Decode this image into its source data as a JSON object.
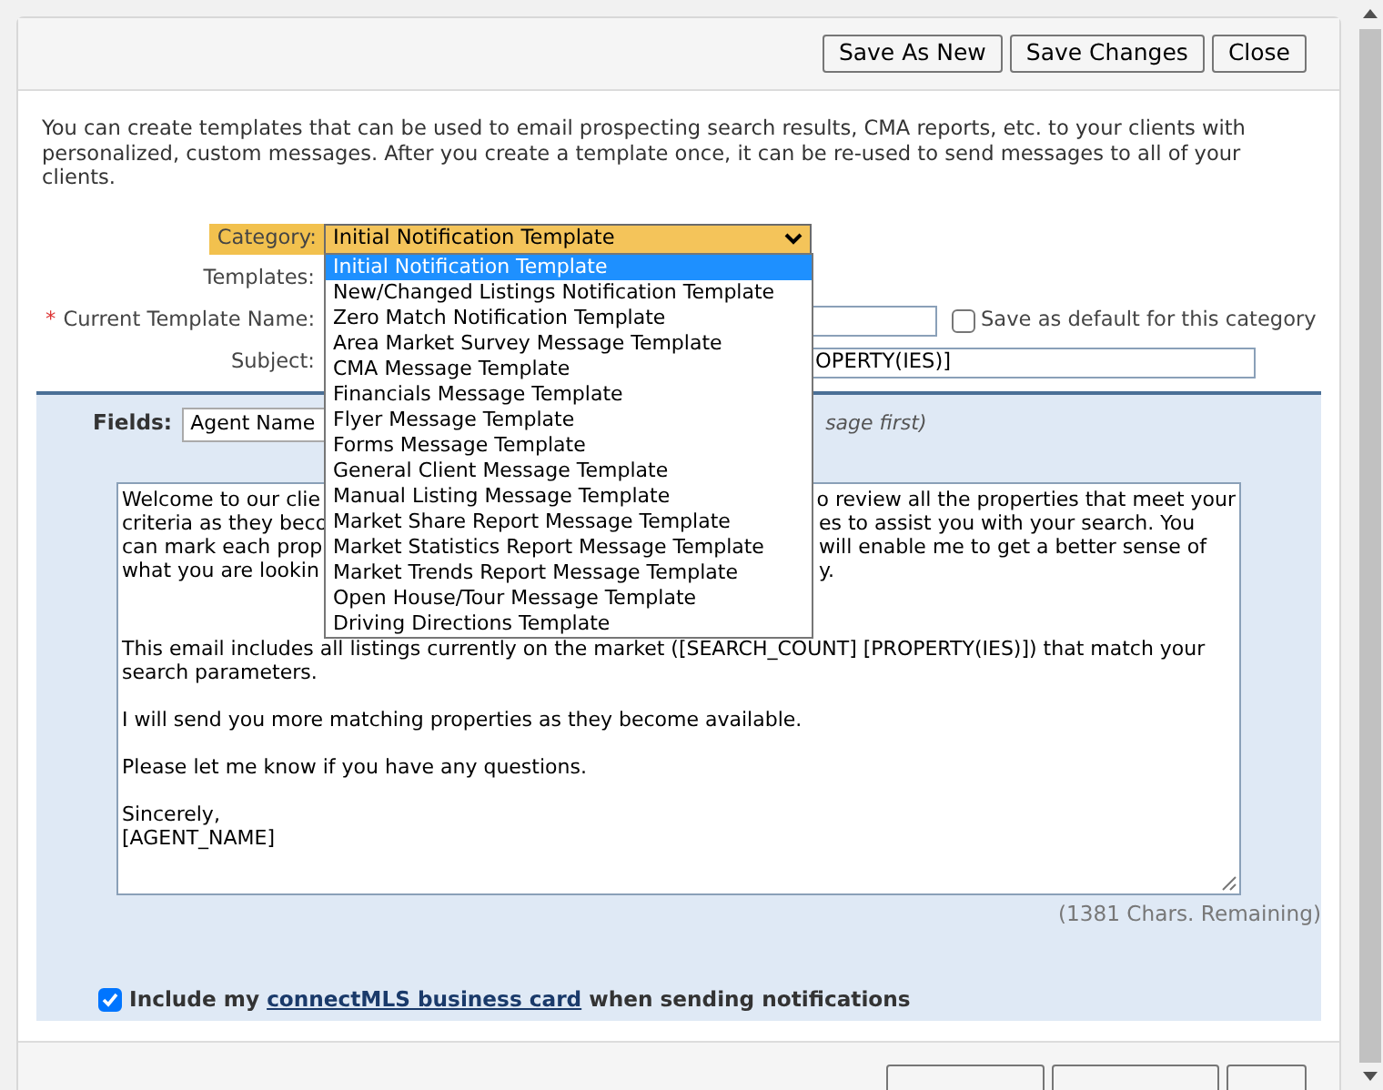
{
  "header_buttons": [
    "Save As New",
    "Save Changes",
    "Close"
  ],
  "intro": "You can create templates that can be used to email prospecting search results, CMA reports, etc. to your clients with personalized, custom messages. After you create a template once, it can be re-used to send messages to all of your clients.",
  "form": {
    "category_label": "Category:",
    "category_value": "Initial Notification Template",
    "templates_label": "Templates:",
    "required_mark": "*",
    "name_label": "Current Template Name:",
    "default_checkbox": {
      "label": "Save as default for this category",
      "checked": false
    },
    "subject_label": "Subject:",
    "subject_value": "OPERTY(IES)]"
  },
  "dropdown": [
    {
      "label": "Initial Notification Template",
      "selected": true
    },
    {
      "label": "New/Changed Listings Notification Template",
      "selected": false
    },
    {
      "label": "Zero Match Notification Template",
      "selected": false
    },
    {
      "label": "Area Market Survey Message Template",
      "selected": false
    },
    {
      "label": "CMA Message Template",
      "selected": false
    },
    {
      "label": "Financials Message Template",
      "selected": false
    },
    {
      "label": "Flyer Message Template",
      "selected": false
    },
    {
      "label": "Forms Message Template",
      "selected": false
    },
    {
      "label": "General Client Message Template",
      "selected": false
    },
    {
      "label": "Manual Listing Message Template",
      "selected": false
    },
    {
      "label": "Market Share Report Message Template",
      "selected": false
    },
    {
      "label": "Market Statistics Report Message Template",
      "selected": false
    },
    {
      "label": "Market Trends Report Message Template",
      "selected": false
    },
    {
      "label": "Open House/Tour Message Template",
      "selected": false
    },
    {
      "label": "Driving Directions Template",
      "selected": false
    }
  ],
  "fields": {
    "label": "Fields:",
    "value": "Agent Name",
    "hint": "sage first)"
  },
  "message": {
    "covered_lines": [
      [
        "Welcome to our clie",
        "o review all the properties that meet your"
      ],
      [
        "criteria as they beco",
        "es to assist you with your search.  You"
      ],
      [
        "can mark each prop",
        "will enable me to get a better sense of"
      ],
      [
        "what you are lookin",
        "y."
      ]
    ],
    "paragraphs": [
      "This email includes all listings currently on the market ([SEARCH_COUNT] [PROPERTY(IES)]) that match your search parameters.",
      "I will send you more matching properties as they become available.",
      "Please let me know if you have any questions.",
      "Sincerely,\n[AGENT_NAME]"
    ]
  },
  "chars_remaining": "(1381 Chars. Remaining)",
  "business_card": {
    "checked": true,
    "before": "Include my",
    "link": "connectMLS business card",
    "after": "when sending notifications"
  }
}
